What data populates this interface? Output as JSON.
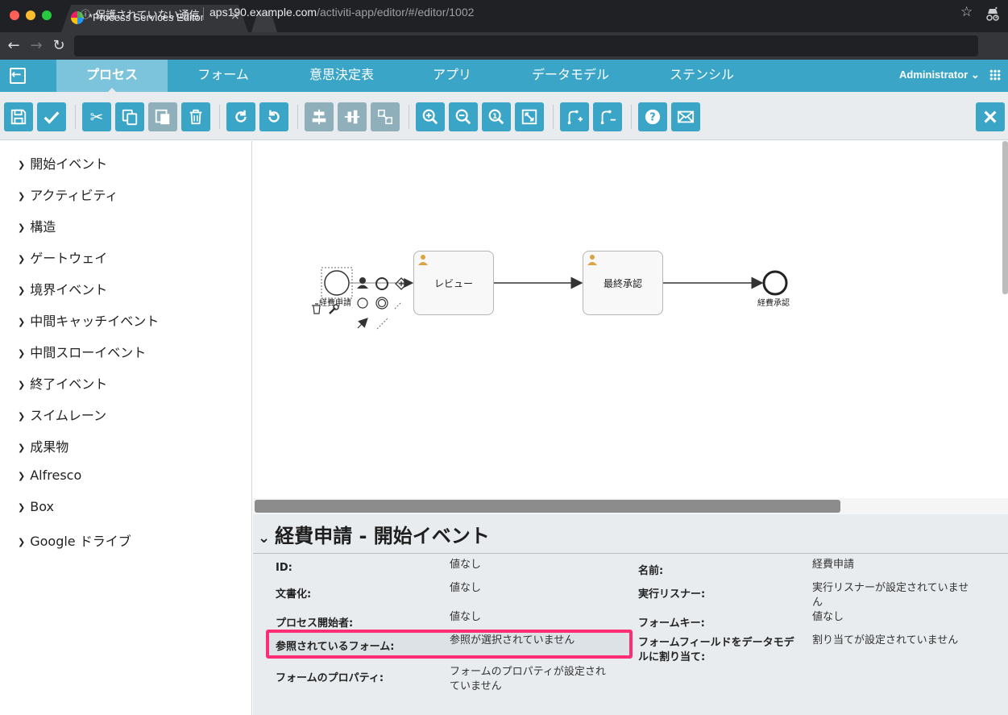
{
  "browser": {
    "tab_title": "*Process Services Editor",
    "security_warning": "保護されていない通信",
    "url_host": "aps190.example.com",
    "url_path": "/activiti-app/editor/#/editor/1002"
  },
  "app_nav": {
    "tabs": [
      "プロセス",
      "フォーム",
      "意思決定表",
      "アプリ",
      "データモデル",
      "ステンシル"
    ],
    "active_tab": "プロセス",
    "user": "Administrator"
  },
  "toolbar": {
    "groups": [
      [
        "save-icon",
        "validate-icon"
      ],
      [
        "cut-icon",
        "copy-icon",
        "paste-icon",
        "delete-icon"
      ],
      [
        "redo-icon",
        "undo-icon"
      ],
      [
        "align-horizontal-icon",
        "align-vertical-icon",
        "same-size-icon"
      ],
      [
        "zoom-in-icon",
        "zoom-out-icon",
        "zoom-actual-icon",
        "zoom-fit-icon"
      ],
      [
        "add-bendpoint-icon",
        "remove-bendpoint-icon"
      ],
      [
        "help-icon",
        "feedback-icon"
      ]
    ],
    "close": "close-icon"
  },
  "palette": {
    "items": [
      "開始イベント",
      "アクティビティ",
      "構造",
      "ゲートウェイ",
      "境界イベント",
      "中間キャッチイベント",
      "中間スローイベント",
      "終了イベント",
      "スイムレーン",
      "成果物",
      "Alfresco",
      "Box",
      "Google ドライブ"
    ]
  },
  "diagram": {
    "start_event_label": "経費申請",
    "task1": "レビュー",
    "task2": "最終承認",
    "end_event_label": "経費承認"
  },
  "properties": {
    "title": "経費申請 - 開始イベント",
    "rows": [
      {
        "label": "ID:",
        "value": "値なし",
        "label2": "名前:",
        "value2": "経費申請"
      },
      {
        "label": "文書化:",
        "value": "値なし",
        "label2": "実行リスナー:",
        "value2": "実行リスナーが設定されていませ\nん"
      },
      {
        "label": "プロセス開始者:",
        "value": "値なし",
        "label2": "フォームキー:",
        "value2": "値なし"
      },
      {
        "label": "参照されているフォーム:",
        "value": "参照が選択されていません",
        "label2": "フォームフィールドをデータモデ\nルに割り当て:",
        "value2": "割り当てが設定されていません"
      },
      {
        "label": "フォームのプロパティ:",
        "value": "フォームのプロパティが設定され\nていません"
      }
    ]
  },
  "colors": {
    "accent": "#3aa5c6",
    "highlight": "#ff2d73"
  }
}
